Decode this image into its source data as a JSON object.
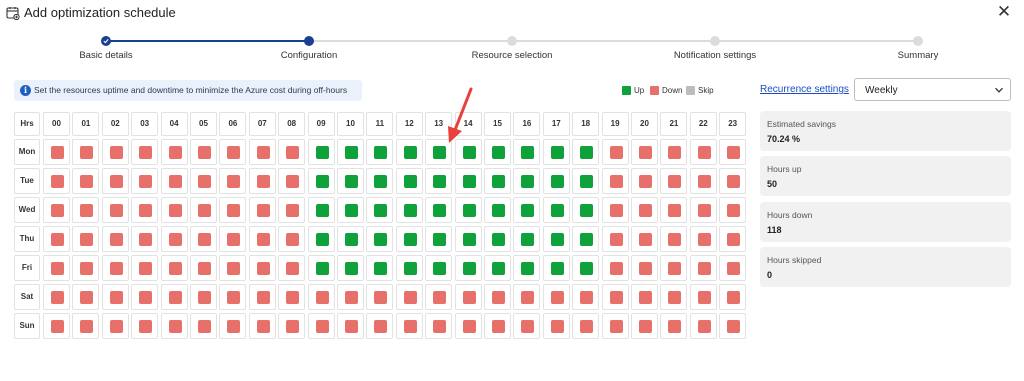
{
  "header": {
    "title": "Add optimization schedule",
    "close_glyph": "✕"
  },
  "stepper": {
    "steps": [
      {
        "label": "Basic details",
        "state": "done"
      },
      {
        "label": "Configuration",
        "state": "current"
      },
      {
        "label": "Resource selection",
        "state": "todo"
      },
      {
        "label": "Notification settings",
        "state": "todo"
      },
      {
        "label": "Summary",
        "state": "todo"
      }
    ]
  },
  "info": {
    "icon_glyph": "i",
    "text": "Set the resources uptime and downtime to minimize the Azure cost during off-hours"
  },
  "legend": {
    "items": [
      {
        "label": "Up",
        "color": "#0fa13a"
      },
      {
        "label": "Down",
        "color": "#e8706a"
      },
      {
        "label": "Skip",
        "color": "#bdbdbd"
      }
    ]
  },
  "grid": {
    "corner_label": "Hrs",
    "hours": [
      "00",
      "01",
      "02",
      "03",
      "04",
      "05",
      "06",
      "07",
      "08",
      "09",
      "10",
      "11",
      "12",
      "13",
      "14",
      "15",
      "16",
      "17",
      "18",
      "19",
      "20",
      "21",
      "22",
      "23"
    ],
    "days": [
      "Mon",
      "Tue",
      "Wed",
      "Thu",
      "Fri",
      "Sat",
      "Sun"
    ],
    "schedule": [
      [
        "down",
        "down",
        "down",
        "down",
        "down",
        "down",
        "down",
        "down",
        "down",
        "up",
        "up",
        "up",
        "up",
        "up",
        "up",
        "up",
        "up",
        "up",
        "up",
        "down",
        "down",
        "down",
        "down",
        "down"
      ],
      [
        "down",
        "down",
        "down",
        "down",
        "down",
        "down",
        "down",
        "down",
        "down",
        "up",
        "up",
        "up",
        "up",
        "up",
        "up",
        "up",
        "up",
        "up",
        "up",
        "down",
        "down",
        "down",
        "down",
        "down"
      ],
      [
        "down",
        "down",
        "down",
        "down",
        "down",
        "down",
        "down",
        "down",
        "down",
        "up",
        "up",
        "up",
        "up",
        "up",
        "up",
        "up",
        "up",
        "up",
        "up",
        "down",
        "down",
        "down",
        "down",
        "down"
      ],
      [
        "down",
        "down",
        "down",
        "down",
        "down",
        "down",
        "down",
        "down",
        "down",
        "up",
        "up",
        "up",
        "up",
        "up",
        "up",
        "up",
        "up",
        "up",
        "up",
        "down",
        "down",
        "down",
        "down",
        "down"
      ],
      [
        "down",
        "down",
        "down",
        "down",
        "down",
        "down",
        "down",
        "down",
        "down",
        "up",
        "up",
        "up",
        "up",
        "up",
        "up",
        "up",
        "up",
        "up",
        "up",
        "down",
        "down",
        "down",
        "down",
        "down"
      ],
      [
        "down",
        "down",
        "down",
        "down",
        "down",
        "down",
        "down",
        "down",
        "down",
        "down",
        "down",
        "down",
        "down",
        "down",
        "down",
        "down",
        "down",
        "down",
        "down",
        "down",
        "down",
        "down",
        "down",
        "down"
      ],
      [
        "down",
        "down",
        "down",
        "down",
        "down",
        "down",
        "down",
        "down",
        "down",
        "down",
        "down",
        "down",
        "down",
        "down",
        "down",
        "down",
        "down",
        "down",
        "down",
        "down",
        "down",
        "down",
        "down",
        "down"
      ]
    ],
    "colors": {
      "up": "#0fa13a",
      "down": "#e8706a",
      "skip": "#bdbdbd"
    }
  },
  "recurrence": {
    "link_label": "Recurrence settings",
    "selected": "Weekly"
  },
  "stats": [
    {
      "label": "Estimated savings",
      "value": "70.24 %"
    },
    {
      "label": "Hours up",
      "value": "50"
    },
    {
      "label": "Hours down",
      "value": "118"
    },
    {
      "label": "Hours skipped",
      "value": "0"
    }
  ]
}
